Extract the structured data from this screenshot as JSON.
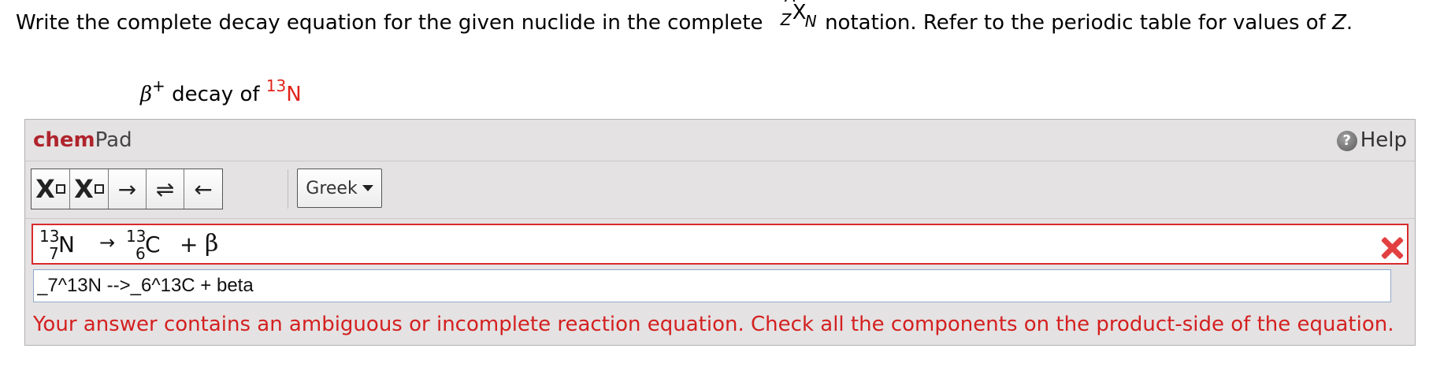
{
  "question": {
    "text_before": "Write the complete decay equation for the given nuclide in the complete",
    "notation": {
      "A": "A",
      "Z": "Z",
      "X": "X",
      "N": "N"
    },
    "text_after": "notation. Refer to the periodic table for values of",
    "z_var": "Z",
    "end_period": "."
  },
  "decay": {
    "beta": "β",
    "charge": "+",
    "text": "decay of",
    "mass": "13",
    "symbol": "N"
  },
  "chempad": {
    "brand_chem": "chem",
    "brand_pad": "Pad",
    "help_icon": "?",
    "help_label": "Help",
    "toolbar": {
      "subscript_x": "X",
      "superscript_x": "X",
      "arrow_right": "→",
      "arrow_equilibrium": "⇌",
      "arrow_left": "←",
      "greek_label": "Greek"
    },
    "equation": {
      "reactant": {
        "mass": "13",
        "atomic": "7",
        "symbol": "N"
      },
      "arrow": "→",
      "product": {
        "mass": "13",
        "atomic": "6",
        "symbol": "C"
      },
      "plus": "+",
      "beta": "β"
    },
    "input_value": "_7^13N -->_6^13C + beta",
    "feedback": "Your answer contains an ambiguous or incomplete reaction equation. Check all the components on the product-side of the equation."
  },
  "colors": {
    "brand_red": "#b0242d",
    "error_red": "#d42020",
    "panel_bg": "#e4e2e3"
  },
  "icons": [
    "help-icon",
    "close-icon"
  ]
}
